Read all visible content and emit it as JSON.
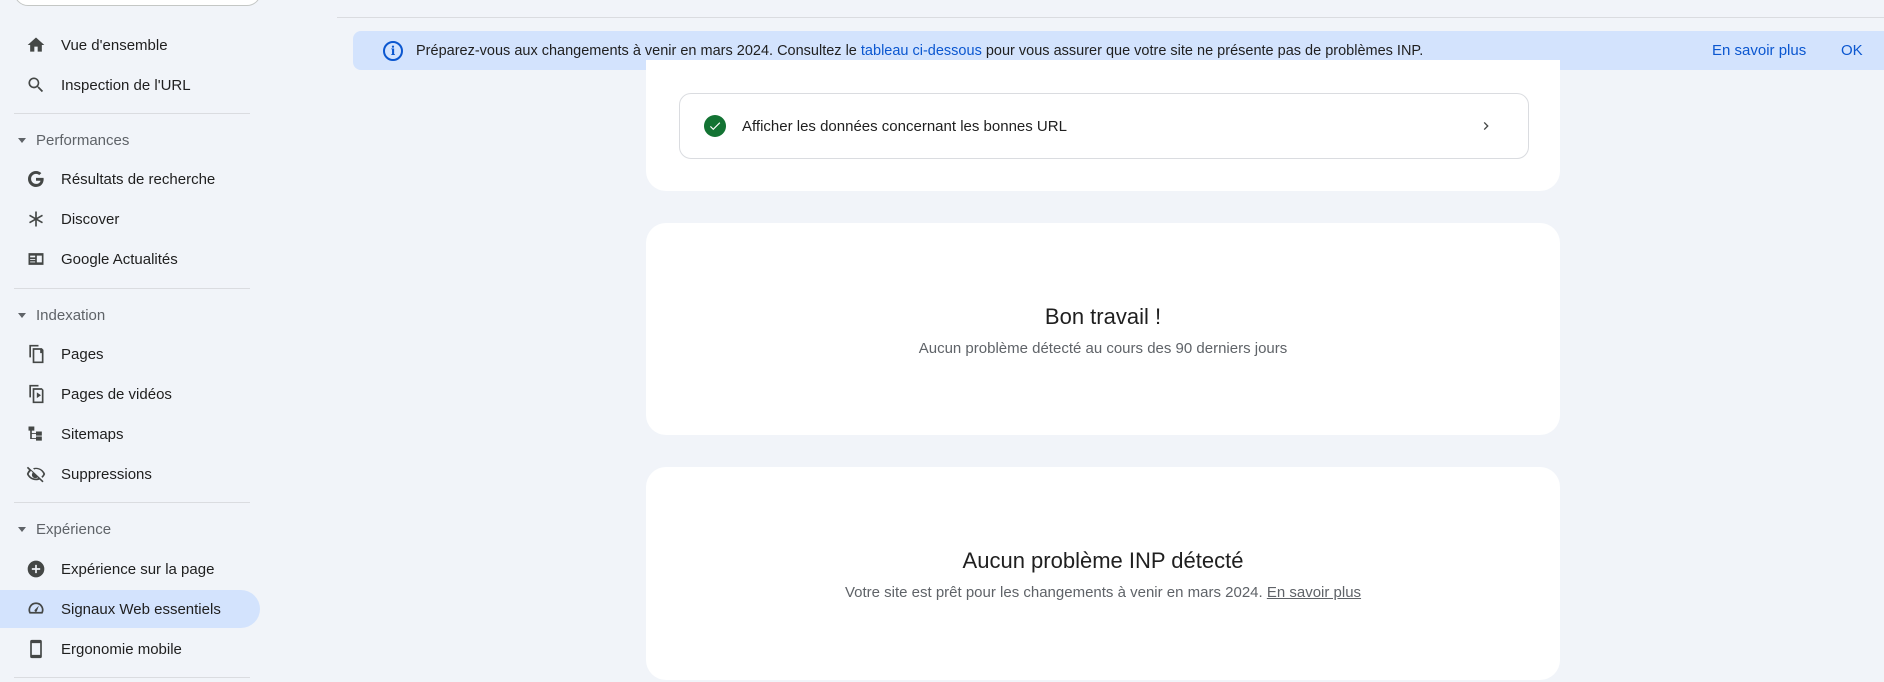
{
  "sidebar": {
    "items_top": [
      {
        "label": "Vue d'ensemble",
        "icon": "home-icon"
      },
      {
        "label": "Inspection de l'URL",
        "icon": "search-icon"
      }
    ],
    "sections": [
      {
        "title": "Performances",
        "items": [
          {
            "label": "Résultats de recherche",
            "icon": "google-g-icon"
          },
          {
            "label": "Discover",
            "icon": "asterisk-icon"
          },
          {
            "label": "Google Actualités",
            "icon": "news-icon"
          }
        ]
      },
      {
        "title": "Indexation",
        "items": [
          {
            "label": "Pages",
            "icon": "pages-icon"
          },
          {
            "label": "Pages de vidéos",
            "icon": "video-pages-icon"
          },
          {
            "label": "Sitemaps",
            "icon": "sitemap-icon"
          },
          {
            "label": "Suppressions",
            "icon": "visibility-off-icon"
          }
        ]
      },
      {
        "title": "Expérience",
        "items": [
          {
            "label": "Expérience sur la page",
            "icon": "add-circle-icon"
          },
          {
            "label": "Signaux Web essentiels",
            "icon": "speed-icon",
            "active": true
          },
          {
            "label": "Ergonomie mobile",
            "icon": "smartphone-icon"
          }
        ]
      }
    ]
  },
  "banner": {
    "text_before": "Préparez-vous aux changements à venir en mars 2024. Consultez le ",
    "link_text": "tableau ci-dessous",
    "text_after": " pour vous assurer que votre site ne présente pas de problèmes INP.",
    "learn_more": "En savoir plus",
    "ok": "OK"
  },
  "good_urls": {
    "label": "Afficher les données concernant les bonnes URL"
  },
  "card_good_job": {
    "title": "Bon travail !",
    "subtitle": "Aucun problème détecté au cours des 90 derniers jours"
  },
  "card_inp": {
    "title": "Aucun problème INP détecté",
    "subtitle": "Votre site est prêt pour les changements à venir en mars 2024. ",
    "link": "En savoir plus"
  },
  "colors": {
    "accent": "#0b57d0",
    "banner_bg": "#d3e3fd",
    "success": "#137333",
    "page_bg": "#f1f4f9"
  }
}
